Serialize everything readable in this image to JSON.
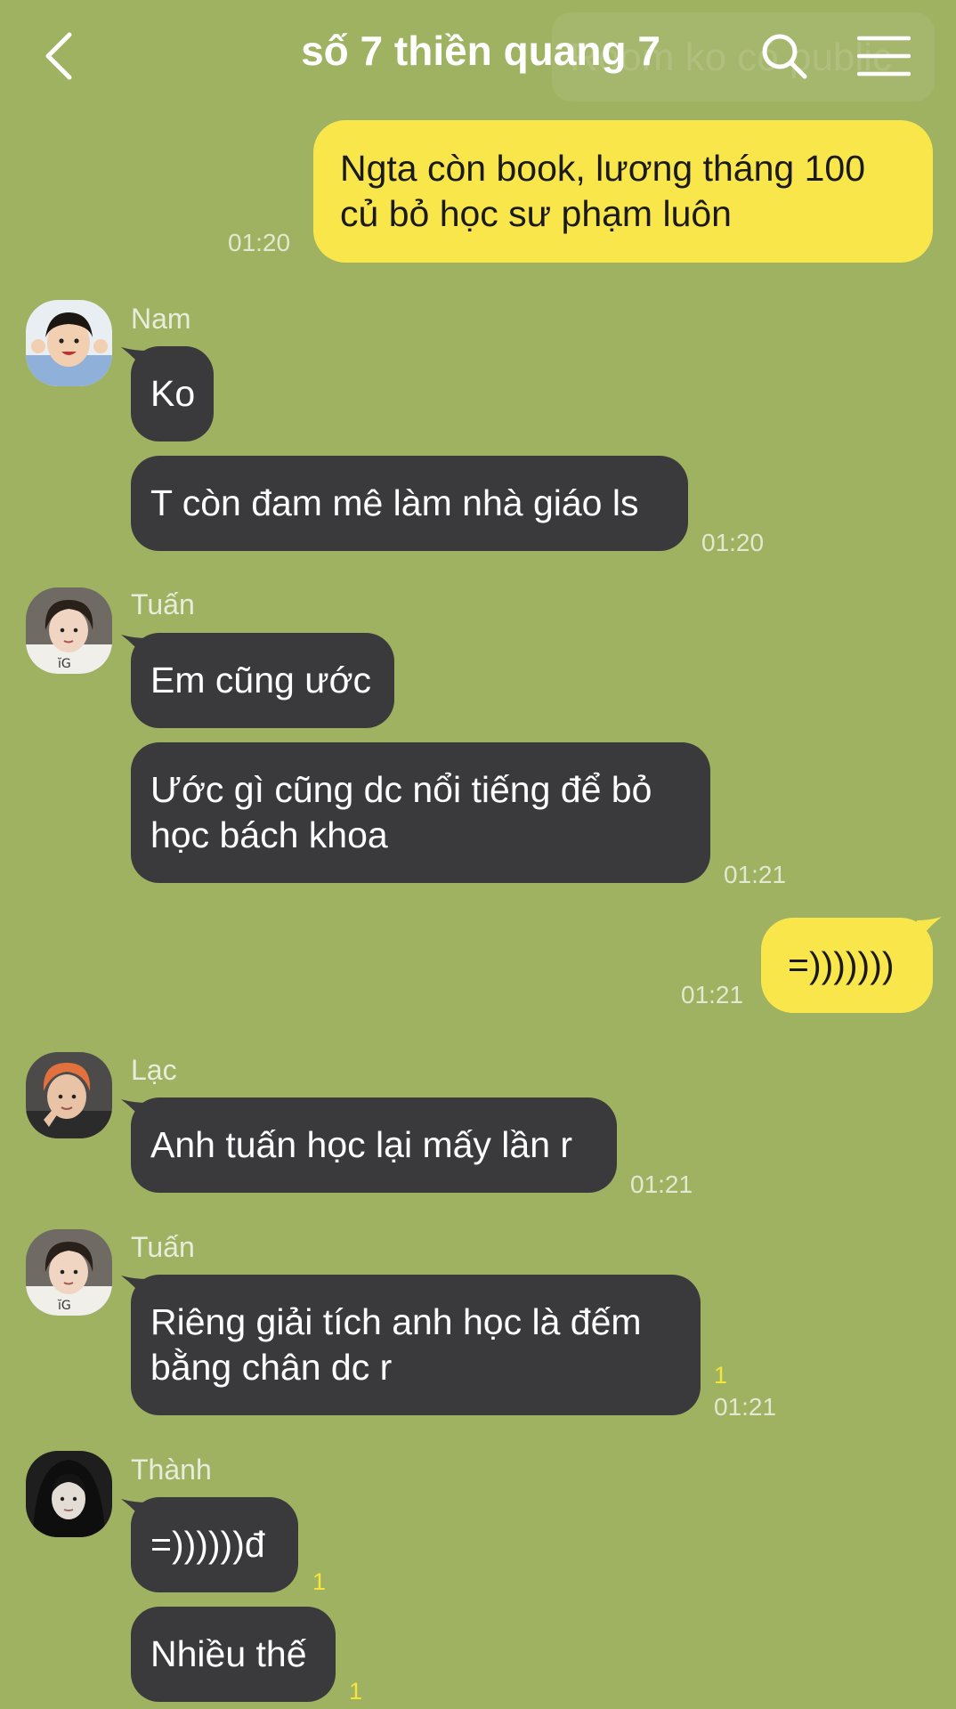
{
  "header": {
    "title": "số 7 thiền quang 7",
    "ghost_text": "Room ko có public"
  },
  "messages": [
    {
      "id": "m1",
      "direction": "out",
      "text": "Ngta còn book, lương tháng 100\ncủ bỏ học sư phạm luôn",
      "time": "01:20"
    },
    {
      "id": "m2",
      "direction": "in",
      "sender": "Nam",
      "text": "Ko"
    },
    {
      "id": "m3",
      "direction": "in",
      "text": "T còn đam mê làm nhà giáo ls",
      "time": "01:20"
    },
    {
      "id": "m4",
      "direction": "in",
      "sender": "Tuấn",
      "text": "Em cũng ước"
    },
    {
      "id": "m5",
      "direction": "in",
      "text": "Ước gì cũng dc nổi tiếng để bỏ\nhọc bách khoa",
      "time": "01:21"
    },
    {
      "id": "m6",
      "direction": "out",
      "text": "=)))))))",
      "time": "01:21"
    },
    {
      "id": "m7",
      "direction": "in",
      "sender": "Lạc",
      "text": "Anh tuấn học lại mấy lần r",
      "time": "01:21"
    },
    {
      "id": "m8",
      "direction": "in",
      "sender": "Tuấn",
      "text": "Riêng giải tích anh học là đếm\nbằng chân dc r",
      "unread": "1",
      "time": "01:21"
    },
    {
      "id": "m9",
      "direction": "in",
      "sender": "Thành",
      "text": "=))))))đ",
      "unread": "1"
    },
    {
      "id": "m10",
      "direction": "in",
      "text": "Nhiều thế",
      "unread": "1"
    }
  ],
  "icons": {
    "back": "chevron-left-icon",
    "search": "search-icon",
    "menu": "hamburger-menu-icon"
  },
  "colors": {
    "background": "#9fb262",
    "incoming_bubble": "#3a3a3c",
    "outgoing_bubble": "#f9e64b",
    "unread_count": "#f5e43c"
  }
}
